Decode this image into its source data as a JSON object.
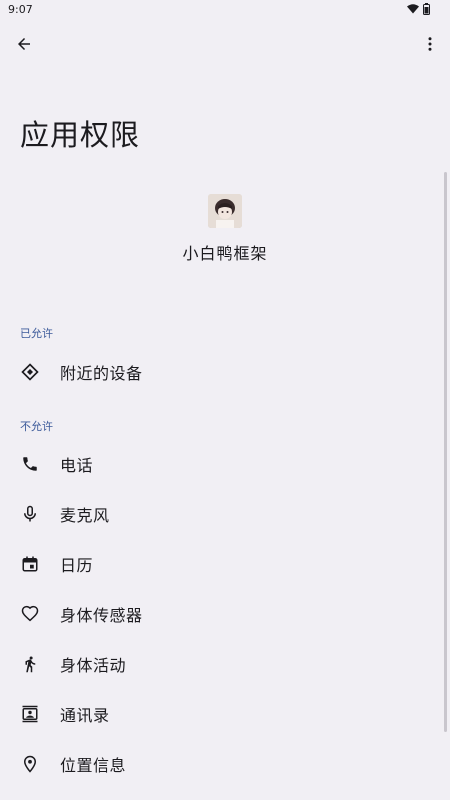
{
  "status_bar": {
    "time": "9:07"
  },
  "page_title": "应用权限",
  "app": {
    "name": "小白鸭框架"
  },
  "sections": {
    "allowed_label": "已允许",
    "denied_label": "不允许"
  },
  "allowed_items": [
    {
      "label": "附近的设备",
      "icon": "nearby-devices-icon"
    }
  ],
  "denied_items": [
    {
      "label": "电话",
      "icon": "phone-icon"
    },
    {
      "label": "麦克风",
      "icon": "microphone-icon"
    },
    {
      "label": "日历",
      "icon": "calendar-icon"
    },
    {
      "label": "身体传感器",
      "icon": "heart-icon"
    },
    {
      "label": "身体活动",
      "icon": "walking-icon"
    },
    {
      "label": "通讯录",
      "icon": "contacts-icon"
    },
    {
      "label": "位置信息",
      "icon": "location-icon"
    }
  ],
  "colors": {
    "background": "#f1eff4",
    "section_label": "#3c5a9a",
    "text": "#1c1b1f"
  }
}
